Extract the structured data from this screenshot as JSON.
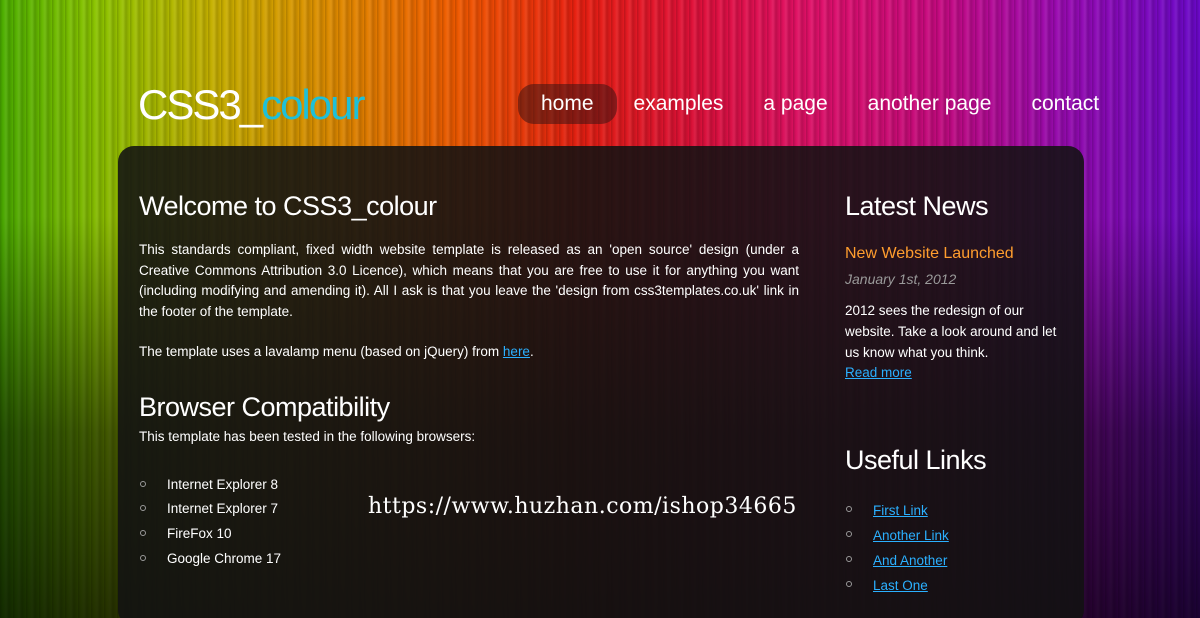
{
  "site": {
    "logo_main": "CSS3_",
    "logo_accent": "colour",
    "accent_color": "#1ec0d8"
  },
  "menu": {
    "items": [
      {
        "label": "home",
        "active": true
      },
      {
        "label": "examples",
        "active": false
      },
      {
        "label": "a page",
        "active": false
      },
      {
        "label": "another page",
        "active": false
      },
      {
        "label": "contact",
        "active": false
      }
    ]
  },
  "main": {
    "title": "Welcome to CSS3_colour",
    "intro": "This standards compliant, fixed width website template is released as an 'open source' design (under a Creative Commons Attribution 3.0 Licence), which means that you are free to use it for anything you want (including modifying and amending it). All I ask is that you leave the 'design from css3templates.co.uk' link in the footer of the template.",
    "lavalamp_text": "The template uses a lavalamp menu (based on jQuery) from ",
    "lavalamp_link": "here",
    "lavalamp_end": "."
  },
  "compatibility": {
    "title": "Browser Compatibility",
    "intro": "This template has been tested in the following browsers:",
    "browsers": [
      "Internet Explorer 8",
      "Internet Explorer 7",
      "FireFox 10",
      "Google Chrome 17"
    ]
  },
  "sidebar": {
    "news_title": "Latest News",
    "news_headline": "New Website Launched",
    "news_date": "January 1st, 2012",
    "news_body": "2012 sees the redesign of our website. Take a look around and let us know what you think.",
    "read_more": "Read more",
    "links_title": "Useful Links",
    "links": [
      "First Link",
      "Another Link",
      "And Another",
      "Last One"
    ]
  },
  "watermark": "https://www.huzhan.com/ishop34665",
  "colors": {
    "link": "#2bb0ff",
    "news_headline": "#ff9d2e",
    "date": "#9a9a9a"
  }
}
